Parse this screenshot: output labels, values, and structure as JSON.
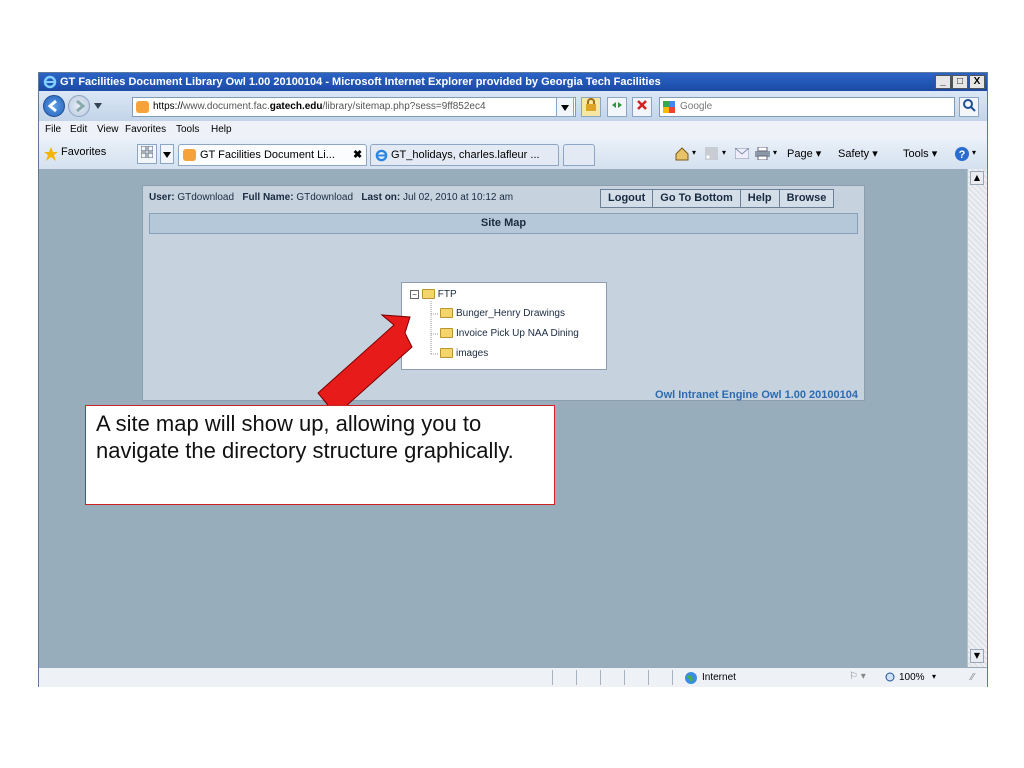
{
  "window": {
    "title": "GT Facilities Document Library Owl 1.00 20100104 - Microsoft Internet Explorer provided by Georgia Tech Facilities",
    "min": "_",
    "max": "□",
    "close": "X"
  },
  "address": {
    "prefix": "https://",
    "host_pre": "www.document.fac.",
    "host_bold": "gatech.edu",
    "path": "/library/sitemap.php?sess=9ff852ec4",
    "search_placeholder": "Google"
  },
  "menu": [
    "File",
    "Edit",
    "View",
    "Favorites",
    "Tools",
    "Help"
  ],
  "favorites_bar": {
    "favorites_label": "Favorites",
    "tabs": [
      {
        "label": "GT Facilities Document Li...",
        "active": true
      },
      {
        "label": "GT_holidays, charles.lafleur ...",
        "active": false
      }
    ],
    "commands": [
      "Page ▾",
      "Safety ▾",
      "Tools ▾"
    ]
  },
  "owl": {
    "user_label": "User:",
    "user_value": "GTdownload",
    "fullname_label": "Full Name:",
    "fullname_value": "GTdownload",
    "laston_label": "Last on:",
    "laston_value": "Jul 02, 2010 at 10:12 am",
    "buttons": [
      "Logout",
      "Go To Bottom",
      "Help",
      "Browse"
    ],
    "sitemap_title": "Site Map",
    "tree": {
      "root": "FTP",
      "children": [
        "Bunger_Henry Drawings",
        "Invoice Pick Up NAA Dining",
        "images"
      ]
    },
    "footer": "Owl Intranet Engine Owl 1.00 20100104"
  },
  "status": {
    "zone": "Internet",
    "zoom": "100%"
  },
  "callout": {
    "text": "A site map will show up, allowing you to navigate the directory structure graphically."
  },
  "colors": {
    "titlebar": "#2b64c6",
    "content_bg": "#97adbc",
    "arrow": "#e81b1b",
    "callout_border": "#cc2222"
  }
}
